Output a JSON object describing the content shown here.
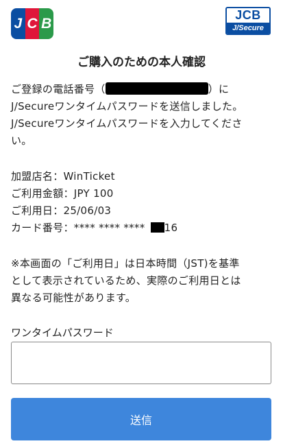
{
  "header": {
    "jcb_logo": {
      "letters": [
        "J",
        "C",
        "B"
      ],
      "colors": [
        "#0b4ea2",
        "#e0163a",
        "#2b9a4a"
      ]
    },
    "jsecure_logo": {
      "top": "JCB",
      "bottom": "J/Secure",
      "color": "#0b4ea2"
    }
  },
  "title": "ご購入のための本人確認",
  "intro": {
    "line1_before": "ご登録の電話番号（",
    "line1_after": "）に",
    "line2": "J/Secureワンタイムパスワードを送信しました。",
    "line3": "J/Secureワンタイムパスワードを入力してくださ",
    "line4": "い。"
  },
  "details": {
    "merchant": "加盟店名：WinTicket",
    "amount": "ご利用金額：JPY 100",
    "date": "ご利用日：25/06/03",
    "card_prefix": "カード番号：**** **** ****",
    "card_suffix": "16"
  },
  "notice": {
    "line1": "※本画面の「ご利用日」は日本時間（JST)を基準",
    "line2": "として表示されているため、実際のご利用日とは",
    "line3": "異なる可能性があります。"
  },
  "otp": {
    "label": "ワンタイムパスワード",
    "value": "",
    "placeholder": ""
  },
  "submit": {
    "label": "送信",
    "color": "#3e86dc"
  }
}
